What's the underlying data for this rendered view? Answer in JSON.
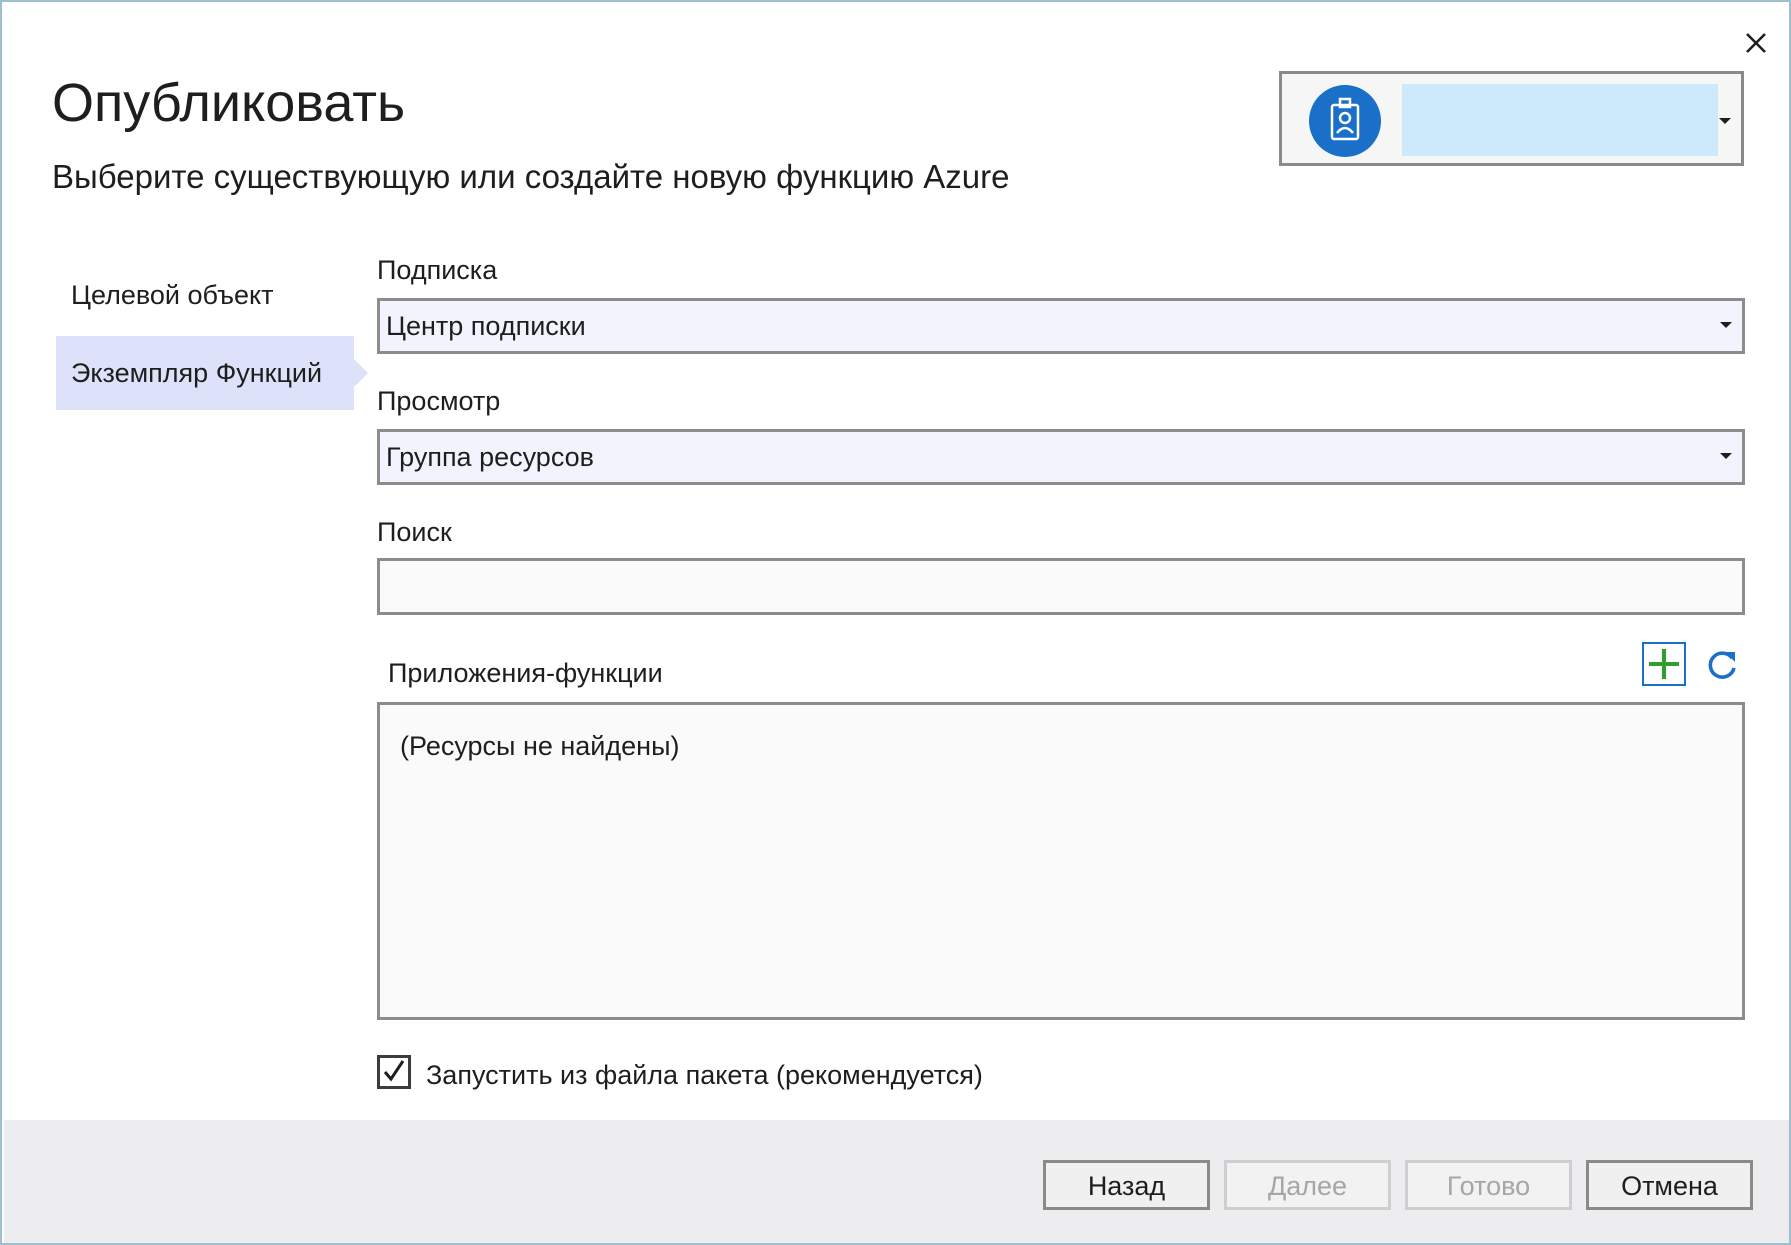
{
  "dialog": {
    "title": "Опубликовать",
    "subtitle": "Выберите существующую или создайте новую функцию Azure"
  },
  "account": {
    "avatar_icon": "badge-icon"
  },
  "nav": {
    "items": [
      {
        "label": "Целевой объект"
      },
      {
        "label": "Экземпляр Функций"
      }
    ],
    "active_index": 1
  },
  "form": {
    "subscription": {
      "label": "Подписка",
      "value": "Центр подписки"
    },
    "view": {
      "label": "Просмотр",
      "value": "Группа ресурсов"
    },
    "search": {
      "label": "Поиск",
      "value": "",
      "placeholder": ""
    }
  },
  "function_apps": {
    "label": "Приложения-функции",
    "empty_text": "(Ресурсы не найдены)",
    "add_icon": "add-icon",
    "refresh_icon": "refresh-icon"
  },
  "run_from_package": {
    "label": "Запустить из файла пакета (рекомендуется)",
    "checked": true
  },
  "buttons": {
    "back": "Назад",
    "next": "Далее",
    "finish": "Готово",
    "cancel": "Отмена"
  },
  "colors": {
    "accent_blue": "#1a6fc9",
    "add_green": "#2e9e2e",
    "selected_nav": "#dde2fa",
    "combo_bg": "#f1f4fd",
    "footer_bg": "#ededf0"
  }
}
